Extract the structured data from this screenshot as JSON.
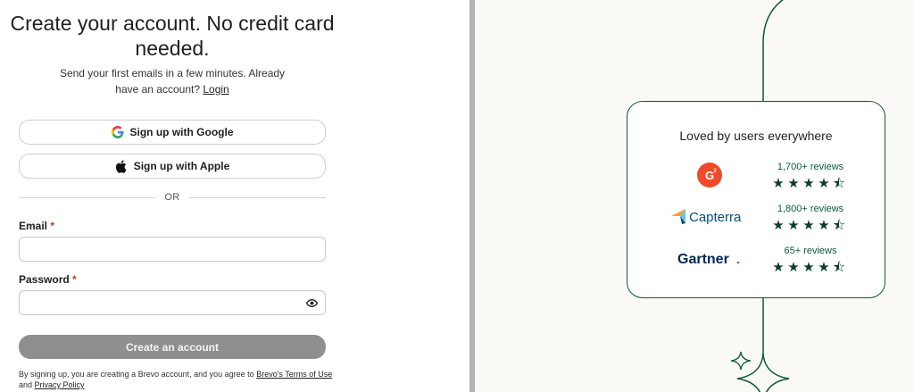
{
  "signup": {
    "title": "Create your account. No credit card needed.",
    "subtitle_prefix": "Send your first emails in a few minutes. Already have an account?",
    "login_link": "Login",
    "google_label": "Sign up with Google",
    "apple_label": "Sign up with Apple",
    "or_text": "OR",
    "email_label": "Email",
    "email_value": "",
    "password_label": "Password",
    "password_value": "",
    "required_mark": "*",
    "create_label": "Create an account",
    "legal_prefix": "By signing up, you are creating a Brevo account, and you agree to",
    "terms_link": "Brevo's Terms of Use",
    "legal_and": "and",
    "privacy_link": "Privacy Policy"
  },
  "reviews_panel": {
    "title": "Loved by users everywhere",
    "items": [
      {
        "brand": "G2",
        "brand_icon": "g2-logo",
        "reviews": "1,700+ reviews",
        "rating": 4.5
      },
      {
        "brand": "Capterra",
        "brand_icon": "capterra-logo",
        "reviews": "1,800+ reviews",
        "rating": 4.5
      },
      {
        "brand": "Gartner",
        "brand_icon": "gartner-logo",
        "reviews": "65+ reviews",
        "rating": 4.5
      }
    ]
  },
  "colors": {
    "accent_green": "#0b5a3a",
    "button_disabled": "#8f8f8f",
    "required_red": "#d93025",
    "g2_red": "#ef4b2a",
    "capterra_blue": "#044d80"
  }
}
